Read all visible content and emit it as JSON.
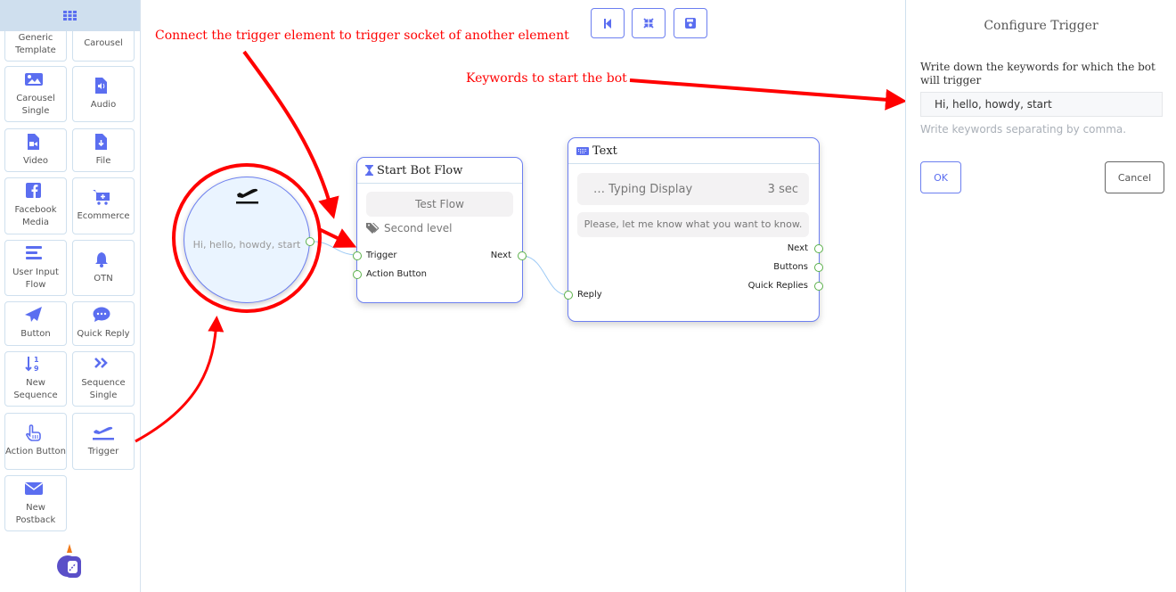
{
  "sidebar": {
    "menu_icon": "grid-icon",
    "items": [
      {
        "label": "Generic Template",
        "icon": "template-icon"
      },
      {
        "label": "Carousel",
        "icon": "carousel-icon"
      },
      {
        "label": "Carousel Single",
        "icon": "image-icon"
      },
      {
        "label": "Audio",
        "icon": "audio-file-icon"
      },
      {
        "label": "Video",
        "icon": "video-file-icon"
      },
      {
        "label": "File",
        "icon": "file-download-icon"
      },
      {
        "label": "Facebook Media",
        "icon": "facebook-icon"
      },
      {
        "label": "Ecommerce",
        "icon": "cart-plus-icon"
      },
      {
        "label": "User Input Flow",
        "icon": "bars-icon"
      },
      {
        "label": "OTN",
        "icon": "bell-icon"
      },
      {
        "label": "Button",
        "icon": "paper-plane-icon"
      },
      {
        "label": "Quick Reply",
        "icon": "chat-bubble-icon"
      },
      {
        "label": "New Sequence",
        "icon": "sort-numeric-icon"
      },
      {
        "label": "Sequence Single",
        "icon": "double-chevron-right-icon"
      },
      {
        "label": "Action Button",
        "icon": "hand-pointer-icon"
      },
      {
        "label": "Trigger",
        "icon": "plane-departure-icon"
      },
      {
        "label": "New Postback",
        "icon": "envelope-icon"
      }
    ]
  },
  "toolbar": {
    "buttons": [
      {
        "name": "reset-button",
        "icon": "step-backward-icon"
      },
      {
        "name": "fit-button",
        "icon": "compress-icon"
      },
      {
        "name": "save-button",
        "icon": "floppy-disk-icon"
      }
    ]
  },
  "canvas": {
    "trigger_node": {
      "keywords": "Hi, hello, howdy, start",
      "icon": "plane-departure-icon"
    },
    "start_node": {
      "title": "Start Bot Flow",
      "test_flow": "Test Flow",
      "label": "Second level",
      "sockets_in": [
        "Trigger",
        "Action Button"
      ],
      "socket_out": "Next"
    },
    "text_node": {
      "title": "Text",
      "typing": "Typing Display",
      "typing_time": "3 sec",
      "message": "Please, let me know what you want to know.",
      "sockets_out": [
        "Next",
        "Buttons",
        "Quick Replies"
      ],
      "socket_in": "Reply"
    }
  },
  "annotations": {
    "connect": "Connect the trigger element to trigger socket of another element",
    "keywords": "Keywords to start the bot",
    "color": "#ff0000"
  },
  "panel": {
    "title": "Configure Trigger",
    "field_label": "Write down the keywords for which the bot will trigger",
    "field_value": "Hi, hello, howdy, start",
    "help": "Write keywords separating by comma.",
    "ok": "OK",
    "cancel": "Cancel"
  },
  "colors": {
    "accent": "#6c7ff0",
    "socket": "#5bb14a",
    "header_bg": "#cfdfee"
  }
}
